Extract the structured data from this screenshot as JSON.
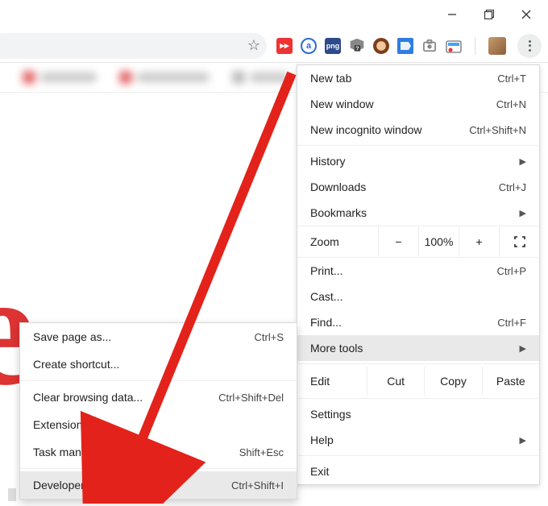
{
  "window": {
    "minimize": "minimize",
    "maximize": "maximize",
    "close": "close"
  },
  "toolbar": {
    "star_tooltip": "Bookmark this page"
  },
  "menu": {
    "new_tab": {
      "label": "New tab",
      "accel": "Ctrl+T"
    },
    "new_window": {
      "label": "New window",
      "accel": "Ctrl+N"
    },
    "new_incognito": {
      "label": "New incognito window",
      "accel": "Ctrl+Shift+N"
    },
    "history": {
      "label": "History"
    },
    "downloads": {
      "label": "Downloads",
      "accel": "Ctrl+J"
    },
    "bookmarks": {
      "label": "Bookmarks"
    },
    "zoom": {
      "label": "Zoom",
      "minus": "−",
      "value": "100%",
      "plus": "+"
    },
    "print": {
      "label": "Print...",
      "accel": "Ctrl+P"
    },
    "cast": {
      "label": "Cast..."
    },
    "find": {
      "label": "Find...",
      "accel": "Ctrl+F"
    },
    "more_tools": {
      "label": "More tools"
    },
    "edit": {
      "label": "Edit",
      "cut": "Cut",
      "copy": "Copy",
      "paste": "Paste"
    },
    "settings": {
      "label": "Settings"
    },
    "help": {
      "label": "Help"
    },
    "exit": {
      "label": "Exit"
    }
  },
  "submenu": {
    "save_page": {
      "label": "Save page as...",
      "accel": "Ctrl+S"
    },
    "create_shortcut": {
      "label": "Create shortcut..."
    },
    "clear_data": {
      "label": "Clear browsing data...",
      "accel": "Ctrl+Shift+Del"
    },
    "extensions": {
      "label": "Extensions"
    },
    "task_manager": {
      "label": "Task manager",
      "accel": "Shift+Esc"
    },
    "dev_tools": {
      "label": "Developer tools",
      "accel": "Ctrl+Shift+I"
    }
  }
}
